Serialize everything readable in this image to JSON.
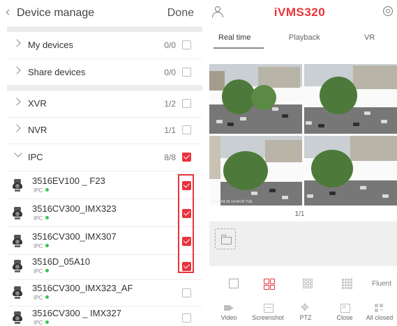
{
  "device_manage": {
    "back_icon": "chevron-left-icon",
    "title": "Device manage",
    "done_label": "Done",
    "groups": [
      {
        "label": "My devices",
        "count": "0/0",
        "checked": false
      },
      {
        "label": "Share devices",
        "count": "0/0",
        "checked": false
      }
    ],
    "types": [
      {
        "label": "XVR",
        "count": "1/2",
        "checked": false
      },
      {
        "label": "NVR",
        "count": "1/1",
        "checked": false
      },
      {
        "label": "IPC",
        "count": "8/8",
        "checked": true,
        "expanded": true
      }
    ],
    "devices": [
      {
        "name": "3516EV100 _ F23",
        "type": "IPC",
        "online": true,
        "checked": true
      },
      {
        "name": "3516CV300_IMX323",
        "type": "IPC",
        "online": true,
        "checked": true
      },
      {
        "name": "3516CV300_IMX307",
        "type": "IPC",
        "online": true,
        "checked": true
      },
      {
        "name": "3516D_05A10",
        "type": "IPC",
        "online": true,
        "checked": true
      },
      {
        "name": "3516CV300_IMX323_AF",
        "type": "IPC",
        "online": true,
        "checked": false
      },
      {
        "name": "3516CV300 _ IMX327",
        "type": "IPC",
        "online": true,
        "checked": false
      }
    ],
    "accent_color": "#e8333a",
    "online_color": "#3cc34a"
  },
  "app": {
    "title": "iVMS320",
    "title_color": "#e8333a",
    "user_icon": "user-icon",
    "scan_icon": "scan-icon"
  },
  "tabs": [
    {
      "label": "Real time",
      "active": true
    },
    {
      "label": "Playback",
      "active": false
    },
    {
      "label": "VR",
      "active": false
    }
  ],
  "preview": {
    "page_indicator": "1/1",
    "folder_icon": "folder-icon"
  },
  "layouts": {
    "options": [
      "single-view-icon",
      "quad-view-icon",
      "nine-view-icon",
      "sixteen-view-icon"
    ],
    "selected": "quad-view-icon",
    "stream_label": "Fluent"
  },
  "toolbar": [
    {
      "label": "Video",
      "icon": "video-icon"
    },
    {
      "label": "Screenshot",
      "icon": "screenshot-icon"
    },
    {
      "label": "PTZ",
      "icon": "ptz-icon"
    },
    {
      "label": "Close",
      "icon": "close-icon"
    },
    {
      "label": "All closed",
      "icon": "all-closed-icon"
    }
  ]
}
